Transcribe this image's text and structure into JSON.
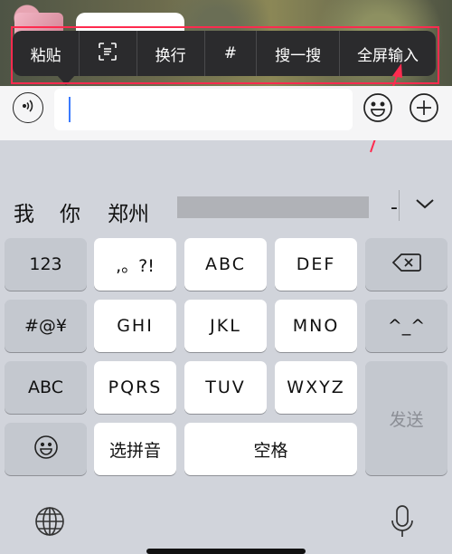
{
  "context_menu": {
    "items": [
      {
        "label": "粘贴"
      },
      {
        "label": ""
      },
      {
        "label": "换行"
      },
      {
        "label": "#"
      },
      {
        "label": "搜一搜"
      },
      {
        "label": "全屏输入"
      }
    ],
    "icons": {
      "scan": "text-scan-icon"
    }
  },
  "input_bar": {
    "icons": {
      "voice": "voice-icon",
      "emoji": "emoji-icon",
      "plus": "plus-icon"
    },
    "value": ""
  },
  "candidates": {
    "words": [
      "我",
      "你",
      "郑州"
    ],
    "trailing": "-",
    "icons": {
      "expand": "chevron-down-icon"
    }
  },
  "keyboard": {
    "row1": [
      "123",
      ",。?!",
      "ABC",
      "DEF"
    ],
    "row2": [
      "#@¥",
      "GHI",
      "JKL",
      "MNO",
      "^_^"
    ],
    "row3": [
      "ABC",
      "PQRS",
      "TUV",
      "WXYZ"
    ],
    "row4": {
      "select_pinyin": "选拼音",
      "space": "空格"
    },
    "send": "发送",
    "icons": {
      "backspace": "backspace-icon",
      "emoji": "emoji-face-icon",
      "globe": "globe-icon",
      "mic": "microphone-icon"
    }
  },
  "colors": {
    "menu_bg": "#2b2b2d",
    "highlight": "#ff2b4f",
    "cursor": "#3a7afe",
    "key_white": "#ffffff",
    "key_gray": "#acb1bb",
    "keyboard_bg": "#d1d4db"
  }
}
